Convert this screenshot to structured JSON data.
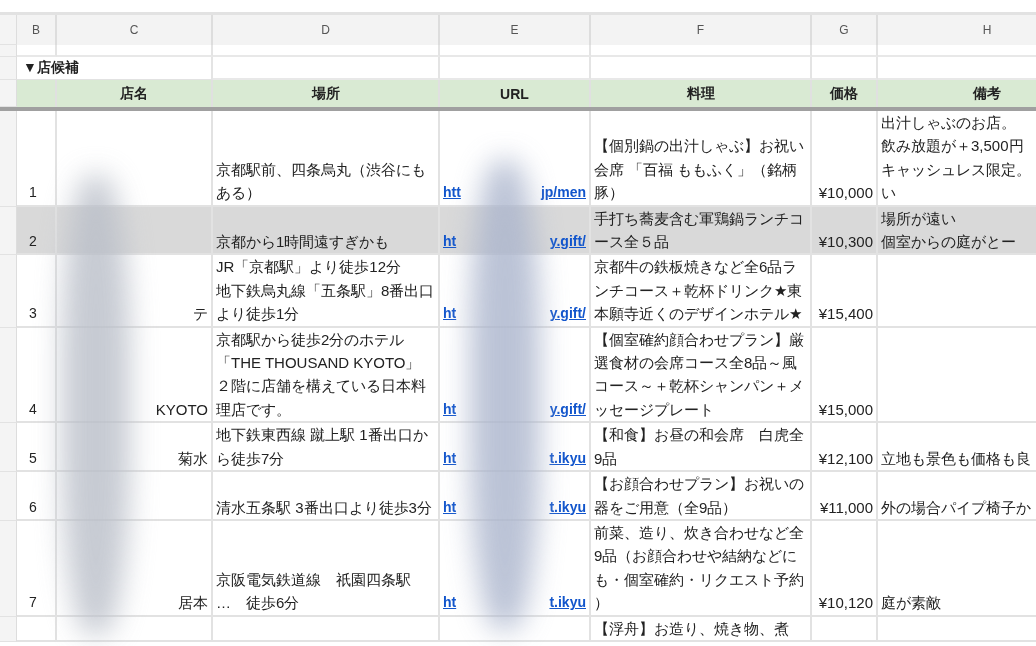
{
  "column_headers": [
    {
      "label": "B"
    },
    {
      "label": "C"
    },
    {
      "label": "D"
    },
    {
      "label": "E"
    },
    {
      "label": "F"
    },
    {
      "label": "G"
    },
    {
      "label": "H"
    }
  ],
  "section_title": "▼店候補",
  "table": {
    "columns": [
      "店名",
      "場所",
      "URL",
      "料理",
      "価格",
      "備考"
    ],
    "rows": [
      {
        "number": "1",
        "highlighted": false,
        "location": [
          "京都駅前、四条烏丸（渋谷にもある）"
        ],
        "url_start": "htt",
        "url_end": "jp/men",
        "dish": "【個別鍋の出汁しゃぶ】お祝い会席 「百福 ももふく」（銘柄豚）",
        "price": "¥10,000",
        "note": [
          "出汁しゃぶのお店。",
          "飲み放題が＋3,500円",
          "キャッシュレス限定。",
          "い"
        ]
      },
      {
        "number": "2",
        "highlighted": true,
        "location": [
          "京都から1時間遠すぎかも"
        ],
        "url_start": "ht",
        "url_end": "y.gift/",
        "dish": "手打ち蕎麦含む軍鶏鍋ランチコース全５品",
        "price": "¥10,300",
        "note": [
          "場所が遠い",
          "個室からの庭がとー"
        ]
      },
      {
        "number": "3",
        "highlighted": false,
        "name": "テ",
        "location": [
          "JR「京都駅」より徒歩12分",
          "地下鉄烏丸線「五条駅」8番出口より徒歩1分"
        ],
        "url_start": "ht",
        "url_end": "y.gift/",
        "dish": "京都牛の鉄板焼きなど全6品ランチコース＋乾杯ドリンク★東本願寺近くのデザインホテル★",
        "price": "¥15,400"
      },
      {
        "number": "4",
        "highlighted": false,
        "name": "KYOTO",
        "location": [
          "京都駅から徒歩2分のホテル",
          "「THE THOUSAND KYOTO」",
          "２階に店舗を構えている日本料理店です。"
        ],
        "url_start": "ht",
        "url_end": "y.gift/",
        "dish": "【個室確約顔合わせプラン】厳選食材の会席コース全8品～風コース～＋乾杯シャンパン＋メッセージプレート",
        "price": "¥15,000"
      },
      {
        "number": "5",
        "highlighted": false,
        "name": "菊水",
        "location": [
          "地下鉄東西線 蹴上駅 1番出口から徒歩7分"
        ],
        "url_start": "ht",
        "url_end": "t.ikyu",
        "dish": "【和食】お昼の和会席　白虎全9品",
        "price": "¥12,100",
        "note": [
          "立地も景色も価格も良"
        ]
      },
      {
        "number": "6",
        "highlighted": false,
        "location": [
          "清水五条駅 3番出口より徒歩3分"
        ],
        "url_start": "ht",
        "url_end": "t.ikyu",
        "dish": "【お顔合わせプラン】お祝いの器をご用意（全9品）",
        "price": "¥11,000",
        "note": [
          "外の場合パイプ椅子か"
        ]
      },
      {
        "number": "7",
        "highlighted": false,
        "name": "居本",
        "location": [
          "京阪電気鉄道線　祇園四条駅",
          "…　徒歩6分"
        ],
        "url_start": "ht",
        "url_end": "t.ikyu",
        "dish": "前菜、造り、炊き合わせなど全9品（お顔合わせや結納などにも・個室確約・リクエスト予約）",
        "price": "¥10,120",
        "note": [
          "庭が素敵"
        ]
      },
      {
        "highlighted": false,
        "dish": "【浮舟】お造り、焼き物、煮"
      }
    ]
  }
}
